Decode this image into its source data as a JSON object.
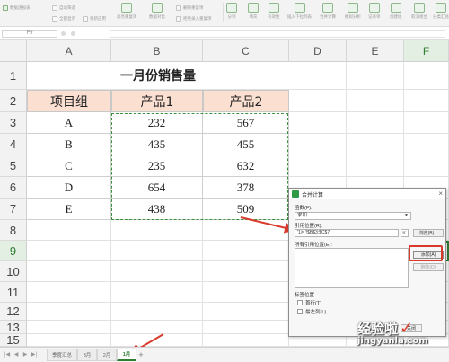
{
  "ribbon": {
    "buttons": [
      "数据透视表",
      "自动筛选",
      "全部显示",
      "重新应用",
      "排序",
      "高亮重复项",
      "数据对比",
      "删除重复项",
      "拒绝录入重复项",
      "分列",
      "填充",
      "有效性",
      "插入下拉列表",
      "合并计算",
      "模拟分析",
      "记录单",
      "创建组",
      "取消组合",
      "分类汇总"
    ]
  },
  "formula_bar": {
    "name_box": "F9"
  },
  "grid": {
    "columns": [
      "A",
      "B",
      "C",
      "D",
      "E",
      "F"
    ],
    "rows": [
      "1",
      "2",
      "3",
      "4",
      "5",
      "6",
      "7",
      "8",
      "9",
      "10",
      "11",
      "12",
      "13",
      "15"
    ],
    "title": "一月份销售量",
    "headers": [
      "项目组",
      "产品1",
      "产品2"
    ],
    "data": [
      [
        "A",
        "232",
        "567"
      ],
      [
        "B",
        "435",
        "455"
      ],
      [
        "C",
        "235",
        "632"
      ],
      [
        "D",
        "654",
        "378"
      ],
      [
        "E",
        "438",
        "509"
      ]
    ]
  },
  "sheet_tabs": {
    "tabs": [
      "季度汇总",
      "3月",
      "2月",
      "1月"
    ],
    "active": "1月",
    "add": "+"
  },
  "dialog": {
    "title": "合并计算",
    "function_label": "函数(F):",
    "function_value": "求和",
    "reference_label": "引用位置(R):",
    "reference_value": "'1月'!$B$3:$C$7",
    "browse_button": "浏览(B)...",
    "all_references_label": "所有引用位置(E):",
    "add_button": "添加(A)",
    "delete_button": "删除(D)",
    "labels_section": "标签位置",
    "first_row": "首行(T)",
    "left_column": "最左列(L)",
    "ok_button": "确定",
    "close_button": "关闭"
  },
  "watermark": {
    "text": "经验啦",
    "check": "✓",
    "url": "jingyanla.com"
  },
  "colors": {
    "accent_green": "#2e7d32",
    "header_fill": "#fbe0d2",
    "annotation_red": "#d93a2b"
  }
}
